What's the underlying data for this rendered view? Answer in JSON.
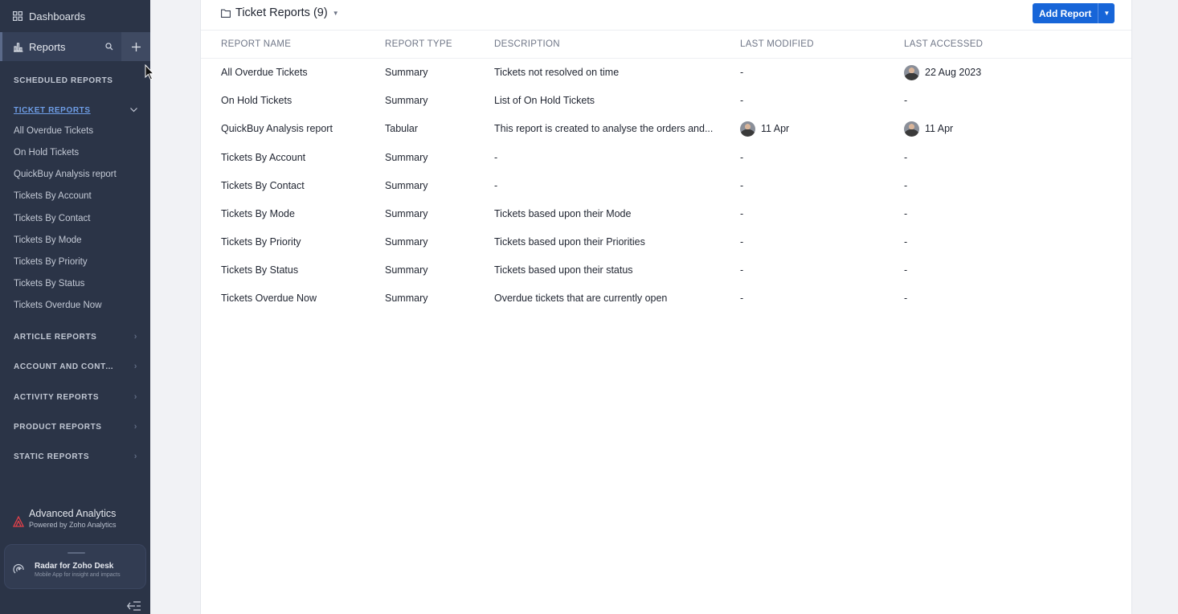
{
  "sidebar": {
    "dashboards_label": "Dashboards",
    "reports_label": "Reports",
    "sections": [
      {
        "label": "SCHEDULED REPORTS"
      },
      {
        "label": "TICKET REPORTS"
      },
      {
        "label": "ARTICLE REPORTS"
      },
      {
        "label": "ACCOUNT AND CONTA..."
      },
      {
        "label": "ACTIVITY REPORTS"
      },
      {
        "label": "PRODUCT REPORTS"
      },
      {
        "label": "STATIC REPORTS"
      }
    ],
    "ticket_items": [
      {
        "label": "All Overdue Tickets"
      },
      {
        "label": "On Hold Tickets"
      },
      {
        "label": "QuickBuy Analysis report"
      },
      {
        "label": "Tickets By Account"
      },
      {
        "label": "Tickets By Contact"
      },
      {
        "label": "Tickets By Mode"
      },
      {
        "label": "Tickets By Priority"
      },
      {
        "label": "Tickets By Status"
      },
      {
        "label": "Tickets Overdue Now"
      }
    ],
    "analytics": {
      "title": "Advanced Analytics",
      "subtitle": "Powered by Zoho Analytics"
    },
    "radar": {
      "title": "Radar for Zoho Desk",
      "subtitle": "Mobile App for insight and impacts"
    }
  },
  "header": {
    "title": "Ticket Reports (9)",
    "add_button": "Add Report"
  },
  "table": {
    "columns": [
      "REPORT NAME",
      "REPORT TYPE",
      "DESCRIPTION",
      "LAST MODIFIED",
      "LAST ACCESSED"
    ],
    "rows": [
      {
        "name": "All Overdue Tickets",
        "type": "Summary",
        "description": "Tickets not resolved on time",
        "modified": "-",
        "accessed": "22 Aug 2023"
      },
      {
        "name": "On Hold Tickets",
        "type": "Summary",
        "description": "List of On Hold Tickets",
        "modified": "-",
        "accessed": "-"
      },
      {
        "name": "QuickBuy Analysis report",
        "type": "Tabular",
        "description": "This report is created to analyse the orders and...",
        "modified": "11 Apr",
        "accessed": "11 Apr"
      },
      {
        "name": "Tickets By Account",
        "type": "Summary",
        "description": "-",
        "modified": "-",
        "accessed": "-"
      },
      {
        "name": "Tickets By Contact",
        "type": "Summary",
        "description": "-",
        "modified": "-",
        "accessed": "-"
      },
      {
        "name": "Tickets By Mode",
        "type": "Summary",
        "description": "Tickets based upon their Mode",
        "modified": "-",
        "accessed": "-"
      },
      {
        "name": "Tickets By Priority",
        "type": "Summary",
        "description": "Tickets based upon their Priorities",
        "modified": "-",
        "accessed": "-"
      },
      {
        "name": "Tickets By Status",
        "type": "Summary",
        "description": "Tickets based upon their status",
        "modified": "-",
        "accessed": "-"
      },
      {
        "name": "Tickets Overdue Now",
        "type": "Summary",
        "description": "Overdue tickets that are currently open",
        "modified": "-",
        "accessed": "-"
      }
    ]
  }
}
